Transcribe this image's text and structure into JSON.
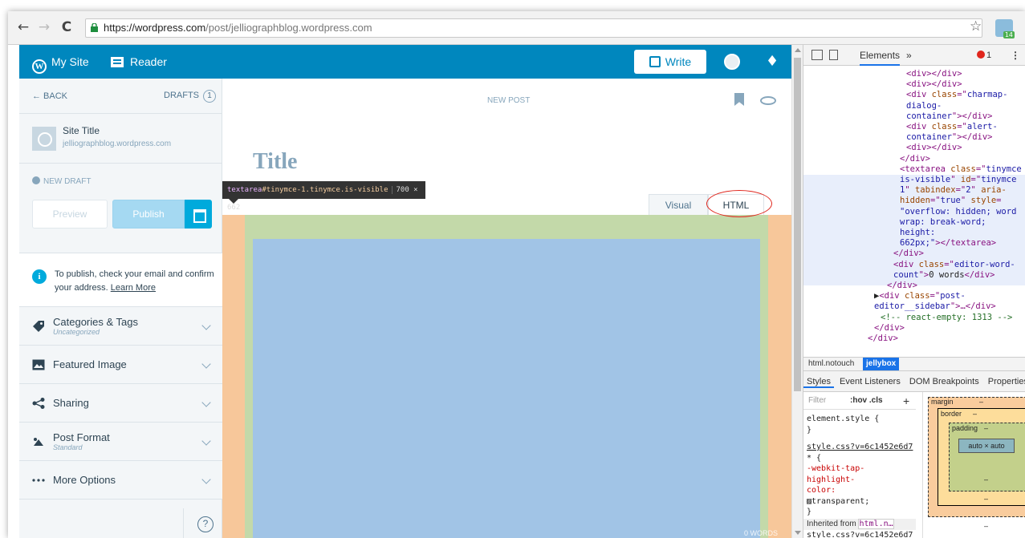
{
  "browser": {
    "back": "←",
    "forward": "→",
    "reload": "C",
    "url_host": "https://wordpress.com",
    "url_path": "/post/jelliographblog.wordpress.com",
    "star": "☆",
    "ext_badge": "14"
  },
  "masterbar": {
    "mysite": "My Site",
    "reader": "Reader",
    "write": "Write",
    "notif_icon": "♦"
  },
  "sidebar": {
    "back": "← BACK",
    "drafts": "DRAFTS",
    "drafts_count": "1",
    "site_title": "Site Title",
    "site_url": "jelliographblog.wordpress.com",
    "new_draft": "NEW DRAFT",
    "preview": "Preview",
    "publish": "Publish",
    "notice_text": "To publish, check your email and confirm your address.",
    "notice_link": "Learn More",
    "sections": [
      {
        "label": "Categories & Tags",
        "sub": "Uncategorized"
      },
      {
        "label": "Featured Image",
        "sub": ""
      },
      {
        "label": "Sharing",
        "sub": ""
      },
      {
        "label": "Post Format",
        "sub": "Standard"
      },
      {
        "label": "More Options",
        "sub": ""
      }
    ],
    "help": "?"
  },
  "editor": {
    "heading": "NEW POST",
    "title_placeholder": "Title",
    "tab_visual": "Visual",
    "tab_html": "HTML",
    "tooltip_tag": "textarea",
    "tooltip_sel": "#tinymce-1.tinymce.is-visible",
    "tooltip_dim": "700 × 662",
    "word_count": "0 WORDS"
  },
  "devtools": {
    "tab_elements": "Elements",
    "more": "»",
    "errors": "1",
    "kebab": "⋮",
    "dom_lines": [
      {
        "indent": 136,
        "parts": [
          [
            "tag",
            "<div></div>"
          ]
        ]
      },
      {
        "indent": 136,
        "parts": [
          [
            "tag",
            "<div></div>"
          ]
        ]
      },
      {
        "indent": 136,
        "parts": [
          [
            "tag",
            "<div "
          ],
          [
            "an",
            "class"
          ],
          [
            "tag",
            "=\""
          ],
          [
            "av",
            "charmap-"
          ]
        ]
      },
      {
        "indent": 136,
        "parts": [
          [
            "av",
            "dialog-"
          ]
        ]
      },
      {
        "indent": 136,
        "parts": [
          [
            "av",
            "container"
          ],
          [
            "tag",
            "\"></div>"
          ]
        ]
      },
      {
        "indent": 136,
        "parts": [
          [
            "tag",
            "<div "
          ],
          [
            "an",
            "class"
          ],
          [
            "tag",
            "=\""
          ],
          [
            "av",
            "alert-"
          ]
        ]
      },
      {
        "indent": 136,
        "parts": [
          [
            "av",
            "container"
          ],
          [
            "tag",
            "\"></div>"
          ]
        ]
      },
      {
        "indent": 136,
        "parts": [
          [
            "tag",
            "<div></div>"
          ]
        ]
      },
      {
        "indent": 128,
        "parts": [
          [
            "tag",
            "</div>"
          ]
        ]
      },
      {
        "indent": 128,
        "parts": [
          [
            "tag",
            "<textarea "
          ],
          [
            "an",
            "class"
          ],
          [
            "tag",
            "=\""
          ],
          [
            "av",
            "tinymce"
          ]
        ]
      },
      {
        "indent": 128,
        "parts": [
          [
            "av",
            "is-visible"
          ],
          [
            "tag",
            "\" "
          ],
          [
            "an",
            "id"
          ],
          [
            "tag",
            "=\""
          ],
          [
            "av",
            "tinymce"
          ]
        ]
      },
      {
        "indent": 128,
        "parts": [
          [
            "av",
            "1"
          ],
          [
            "tag",
            "\" "
          ],
          [
            "an",
            "tabindex"
          ],
          [
            "tag",
            "=\""
          ],
          [
            "av",
            "2"
          ],
          [
            "tag",
            "\" "
          ],
          [
            "an",
            "aria-"
          ]
        ]
      },
      {
        "indent": 128,
        "parts": [
          [
            "an",
            "hidden"
          ],
          [
            "tag",
            "=\""
          ],
          [
            "av",
            "true"
          ],
          [
            "tag",
            "\" "
          ],
          [
            "an",
            "style"
          ],
          [
            "tag",
            "="
          ]
        ]
      },
      {
        "indent": 128,
        "parts": [
          [
            "av",
            "\"overflow: hidden; word"
          ]
        ]
      },
      {
        "indent": 128,
        "parts": [
          [
            "av",
            "wrap: break-word;"
          ]
        ]
      },
      {
        "indent": 128,
        "parts": [
          [
            "av",
            "height:"
          ]
        ]
      },
      {
        "indent": 128,
        "parts": [
          [
            "av",
            "662px;\""
          ],
          [
            "tag",
            "></textarea>"
          ]
        ]
      },
      {
        "indent": 120,
        "parts": [
          [
            "tag",
            "</div>"
          ]
        ]
      },
      {
        "indent": 120,
        "parts": [
          [
            "tag",
            "<div "
          ],
          [
            "an",
            "class"
          ],
          [
            "tag",
            "=\""
          ],
          [
            "av",
            "editor-word-"
          ]
        ]
      },
      {
        "indent": 120,
        "parts": [
          [
            "av",
            "count"
          ],
          [
            "tag",
            "\">"
          ],
          [
            "tx",
            "0 words"
          ],
          [
            "tag",
            "</div>"
          ]
        ]
      },
      {
        "indent": 112,
        "parts": [
          [
            "tag",
            "</div>"
          ]
        ]
      },
      {
        "indent": 96,
        "parts": [
          [
            "tx",
            "▶"
          ],
          [
            "tag",
            "<div "
          ],
          [
            "an",
            "class"
          ],
          [
            "tag",
            "=\""
          ],
          [
            "av",
            "post-"
          ]
        ]
      },
      {
        "indent": 96,
        "parts": [
          [
            "av",
            "editor__sidebar"
          ],
          [
            "tag",
            "\">…</div>"
          ]
        ]
      },
      {
        "indent": 104,
        "parts": [
          [
            "cm",
            "<!-- react-empty: 1313 -->"
          ]
        ]
      },
      {
        "indent": 96,
        "parts": [
          [
            "tag",
            "</div>"
          ]
        ]
      },
      {
        "indent": 88,
        "parts": [
          [
            "tag",
            "</div>"
          ]
        ]
      }
    ],
    "crumb1": "html.notouch",
    "crumb2": "jellybox",
    "style_tabs": [
      "Styles",
      "Event Listeners",
      "DOM Breakpoints",
      "Properties"
    ],
    "filter_placeholder": "Filter",
    "hovcls": ":hov  .cls",
    "plus": "+",
    "styles_lines": [
      {
        "cls": "",
        "text": "element.style {"
      },
      {
        "cls": "",
        "text": "}"
      },
      {
        "cls": "link",
        "text": "style.css?v=6c1452e6d7"
      },
      {
        "cls": "",
        "text": "* {"
      },
      {
        "cls": "prop",
        "text": "  -webkit-tap-"
      },
      {
        "cls": "prop",
        "text": "     highlight-"
      },
      {
        "cls": "prop",
        "text": "     color:"
      },
      {
        "cls": "",
        "text": "     ▨transparent;"
      },
      {
        "cls": "",
        "text": "}"
      }
    ],
    "inherited_label": "Inherited from",
    "inherited_code": "html.n…",
    "last_link": "style.css?v=6c1452e6d7",
    "bm_margin": "margin",
    "bm_border": "border",
    "bm_padding": "padding",
    "bm_content": "auto × auto",
    "bm_dash": "–"
  }
}
